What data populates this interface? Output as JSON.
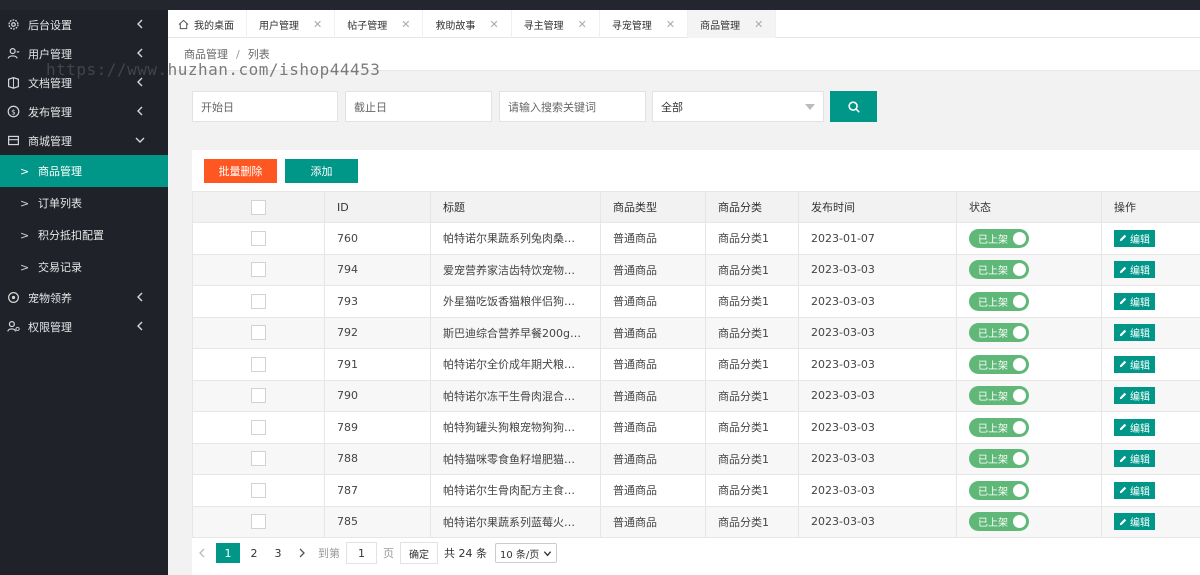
{
  "watermark": "https://www.huzhan.com/ishop44453",
  "sidebar": {
    "items": [
      {
        "label": "后台设置",
        "icon": "gear-icon"
      },
      {
        "label": "用户管理",
        "icon": "user-icon"
      },
      {
        "label": "文档管理",
        "icon": "book-icon"
      },
      {
        "label": "发布管理",
        "icon": "dollar-icon"
      },
      {
        "label": "商城管理",
        "icon": "shop-icon"
      }
    ],
    "sub_items": [
      {
        "label": "商品管理",
        "active": true
      },
      {
        "label": "订单列表",
        "active": false
      },
      {
        "label": "积分抵扣配置",
        "active": false
      },
      {
        "label": "交易记录",
        "active": false
      }
    ],
    "items_after": [
      {
        "label": "宠物领养",
        "icon": "paw-icon"
      },
      {
        "label": "权限管理",
        "icon": "user-settings-icon"
      }
    ]
  },
  "tabs": [
    {
      "label": "我的桌面",
      "home": true
    },
    {
      "label": "用户管理"
    },
    {
      "label": "帖子管理"
    },
    {
      "label": "救助故事"
    },
    {
      "label": "寻主管理"
    },
    {
      "label": "寻宠管理"
    },
    {
      "label": "商品管理",
      "active": true
    }
  ],
  "breadcrumb": {
    "parent": "商品管理",
    "sep": "/",
    "current": "列表"
  },
  "filter": {
    "start_placeholder": "开始日",
    "end_placeholder": "截止日",
    "keyword_placeholder": "请输入搜索关键词",
    "status_value": "全部"
  },
  "toolbar": {
    "batch_delete": "批量删除",
    "add": "添加"
  },
  "table": {
    "headers": [
      "ID",
      "标题",
      "商品类型",
      "商品分类",
      "发布时间",
      "状态",
      "操作"
    ],
    "status_label": "已上架",
    "edit_label": "编辑",
    "rows": [
      {
        "id": "760",
        "title": "帕特诺尔果蔬系列兔肉桑…",
        "type": "普通商品",
        "category": "商品分类1",
        "date": "2023-01-07"
      },
      {
        "id": "794",
        "title": "爱宠营养家洁齿特饮宠物…",
        "type": "普通商品",
        "category": "商品分类1",
        "date": "2023-03-03"
      },
      {
        "id": "793",
        "title": "外星猫吃饭香猫粮伴侣狗…",
        "type": "普通商品",
        "category": "商品分类1",
        "date": "2023-03-03"
      },
      {
        "id": "792",
        "title": "斯巴迪综合营养早餐200g…",
        "type": "普通商品",
        "category": "商品分类1",
        "date": "2023-03-03"
      },
      {
        "id": "791",
        "title": "帕特诺尔全价成年期犬粮…",
        "type": "普通商品",
        "category": "商品分类1",
        "date": "2023-03-03"
      },
      {
        "id": "790",
        "title": "帕特诺尔冻干生骨肉混合…",
        "type": "普通商品",
        "category": "商品分类1",
        "date": "2023-03-03"
      },
      {
        "id": "789",
        "title": "帕特狗罐头狗粮宠物狗狗…",
        "type": "普通商品",
        "category": "商品分类1",
        "date": "2023-03-03"
      },
      {
        "id": "788",
        "title": "帕特猫咪零食鱼籽增肥猫…",
        "type": "普通商品",
        "category": "商品分类1",
        "date": "2023-03-03"
      },
      {
        "id": "787",
        "title": "帕特诺尔生骨肉配方主食…",
        "type": "普通商品",
        "category": "商品分类1",
        "date": "2023-03-03"
      },
      {
        "id": "785",
        "title": "帕特诺尔果蔬系列蓝莓火…",
        "type": "普通商品",
        "category": "商品分类1",
        "date": "2023-03-03"
      }
    ]
  },
  "pagination": {
    "pages": [
      "1",
      "2",
      "3"
    ],
    "current": "1",
    "goto_label": "到第",
    "goto_value": "1",
    "page_unit": "页",
    "confirm": "确定",
    "total": "共 24 条",
    "page_size": "10 条/页"
  },
  "colors": {
    "accent": "#009688",
    "danger": "#ff5722",
    "switch_on": "#5fb878",
    "sidebar_bg": "#20222a"
  }
}
